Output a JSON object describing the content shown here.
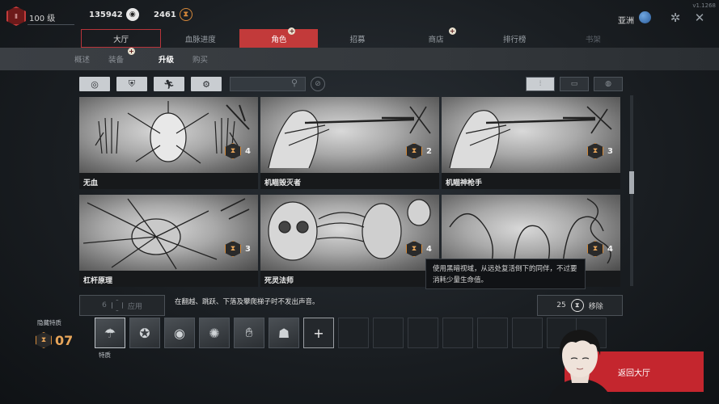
{
  "player": {
    "level_text": "100 级",
    "rank_icon": "rank-hex-icon",
    "rank_icon_text": "Ⅱ"
  },
  "currencies": {
    "bloodpoints": {
      "value": "135942",
      "icon": "bloodpoints-icon"
    },
    "iridescent_shards": {
      "value": "2461",
      "icon": "shards-icon"
    }
  },
  "region": {
    "label": "亚洲",
    "icon": "globe-icon"
  },
  "version": "v1.1268",
  "top_icons": [
    "game-wheel-icon",
    "close-icon"
  ],
  "main_tabs": [
    {
      "label": "大厅",
      "state": "boxed"
    },
    {
      "label": "血脉进度",
      "state": "normal"
    },
    {
      "label": "角色",
      "state": "active",
      "badge": "+"
    },
    {
      "label": "招募",
      "state": "normal"
    },
    {
      "label": "商店",
      "state": "normal",
      "badge": "+"
    },
    {
      "label": "排行榜",
      "state": "normal"
    },
    {
      "label": "书架",
      "state": "dim"
    }
  ],
  "sub_tabs": [
    {
      "label": "概述",
      "active": false
    },
    {
      "label": "装备",
      "active": false,
      "badge": "+"
    },
    {
      "label": "升级",
      "active": true
    },
    {
      "label": "购买",
      "active": false
    }
  ],
  "filters": [
    "target-icon",
    "shield-icon",
    "runner-icon",
    "gear-icon"
  ],
  "search": {
    "placeholder": ""
  },
  "sort_buttons": [
    "sort-icon",
    "list-icon",
    "chat-icon"
  ],
  "perks": [
    {
      "name": "无血",
      "cost": "4",
      "art": "hands-face"
    },
    {
      "name": "机瞄毁灭者",
      "cost": "2",
      "art": "rifle-man"
    },
    {
      "name": "机瞄神枪手",
      "cost": "3",
      "art": "rifle-man"
    },
    {
      "name": "杠杆原理",
      "cost": "3",
      "art": "brain-burst"
    },
    {
      "name": "死灵法师",
      "cost": "4",
      "art": "skull-face"
    },
    {
      "name": "",
      "cost": "4",
      "art": "serpents"
    }
  ],
  "tooltip": "使用黑暗视域，从远处复活倒下的同伴，不过要消耗少量生命值。",
  "apply": {
    "count": "6",
    "label": "应用"
  },
  "description": "在翻越、跳跃、下落及攀爬梯子时不发出声音。",
  "remove": {
    "count": "25",
    "label": "移除"
  },
  "hidden_perks": {
    "label": "隐藏特质",
    "count": "07"
  },
  "loadout": {
    "label": "特质",
    "slots": [
      {
        "icon": "parachute-icon"
      },
      {
        "icon": "badge-icon"
      },
      {
        "icon": "eye-icon"
      },
      {
        "icon": "sparkle-icon"
      },
      {
        "icon": "hand-icon"
      },
      {
        "icon": "fox-icon"
      }
    ],
    "add_label": "+"
  },
  "return_button": "返回大厅",
  "colors": {
    "accent_red": "#c4262e",
    "shard_orange": "#d48a3a",
    "panel_bg": "#1a1e22"
  }
}
